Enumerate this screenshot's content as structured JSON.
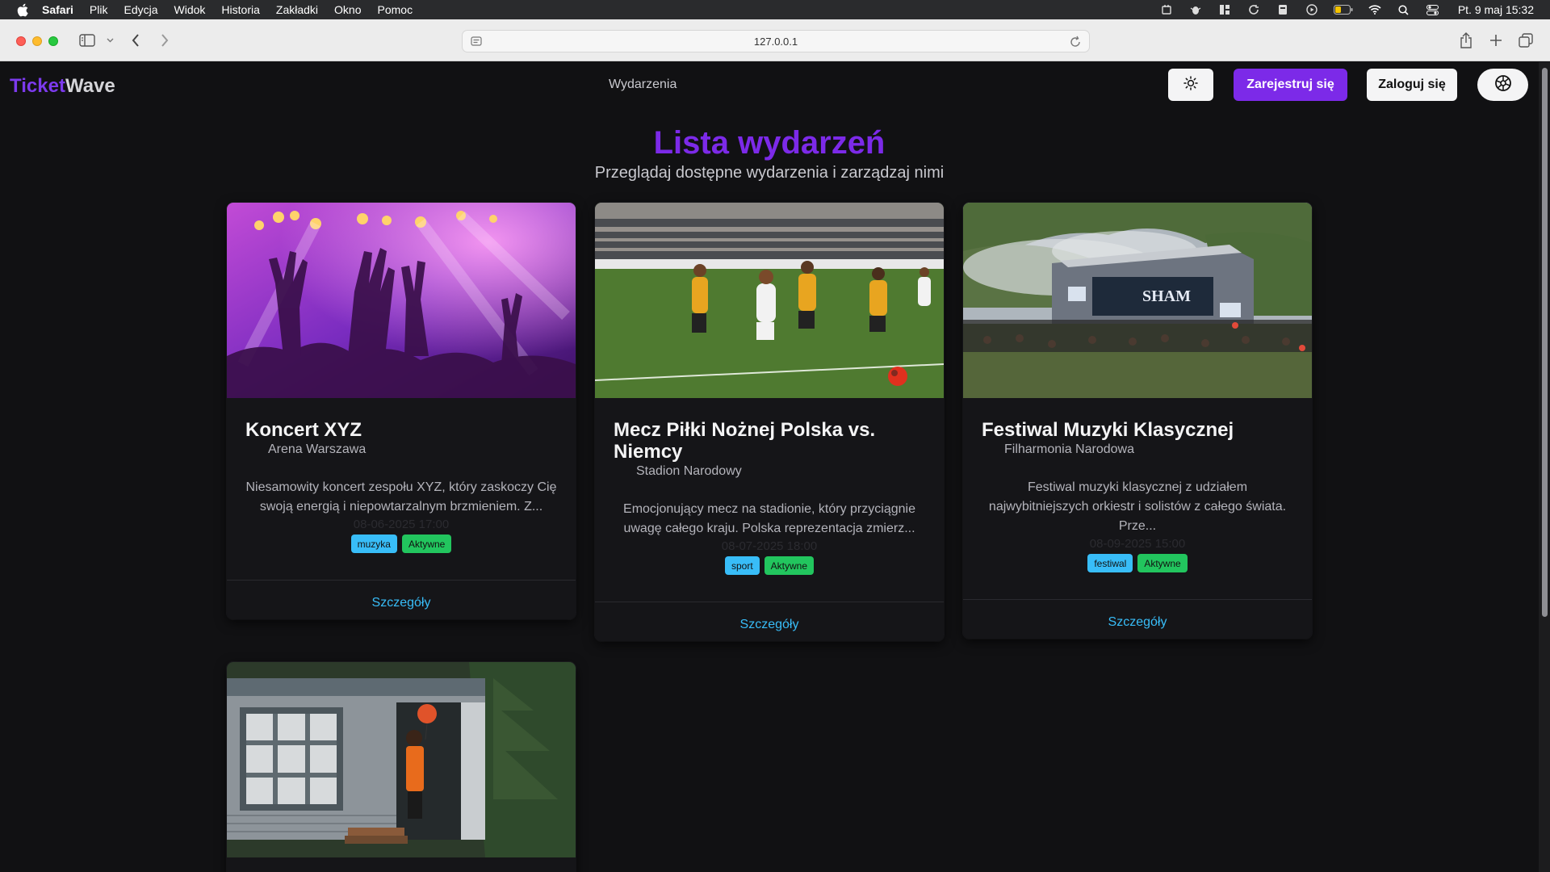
{
  "menubar": {
    "app": "Safari",
    "items": [
      "Plik",
      "Edycja",
      "Widok",
      "Historia",
      "Zakładki",
      "Okno",
      "Pomoc"
    ],
    "clock": "Pt. 9 maj  15:32"
  },
  "browser": {
    "url": "127.0.0.1"
  },
  "nav": {
    "logo_part1": "Ticket",
    "logo_part2": "Wave",
    "link_events": "Wydarzenia",
    "register_label": "Zarejestruj się",
    "login_label": "Zaloguj się"
  },
  "header": {
    "title": "Lista wydarzeń",
    "subtitle": "Przeglądaj dostępne wydarzenia i zarządzaj nimi"
  },
  "events": [
    {
      "title": "Koncert XYZ",
      "venue": "Arena Warszawa",
      "description": "Niesamowity koncert zespołu XYZ, który zaskoczy Cię swoją energią i niepowtarzalnym brzmieniem. Z...",
      "date": "08-06-2025 17:00",
      "category": "muzyka",
      "status": "Aktywne",
      "link": "Szczegóły"
    },
    {
      "title": "Mecz Piłki Nożnej Polska vs. Niemcy",
      "venue": "Stadion Narodowy",
      "description": "Emocjonujący mecz na stadionie, który przyciągnie uwagę całego kraju. Polska reprezentacja zmierz...",
      "date": "08-07-2025 18:00",
      "category": "sport",
      "status": "Aktywne",
      "link": "Szczegóły"
    },
    {
      "title": "Festiwal Muzyki Klasycznej",
      "venue": "Filharmonia Narodowa",
      "description": "Festiwal muzyki klasycznej z udziałem najwybitniejszych orkiestr i solistów z całego świata. Prze...",
      "date": "08-09-2025 15:00",
      "category": "festiwal",
      "status": "Aktywne",
      "link": "Szczegóły"
    }
  ],
  "colors": {
    "accent": "#7c2ae8",
    "link": "#38bdf8",
    "tag_category": "#38bdf8",
    "tag_status": "#22c55e",
    "background": "#111113"
  }
}
